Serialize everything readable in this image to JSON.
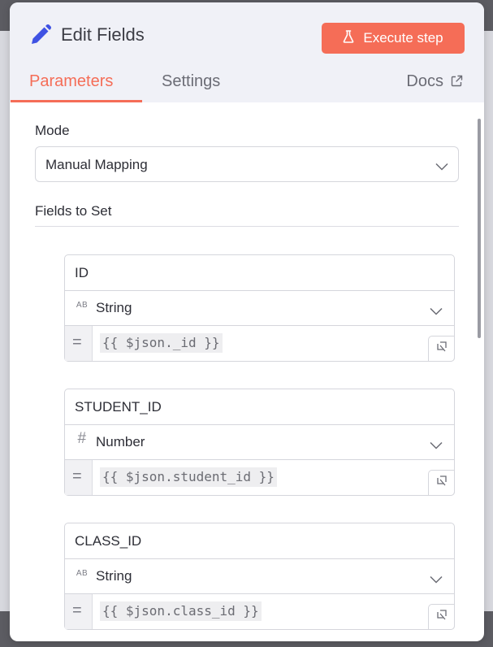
{
  "header": {
    "title": "Edit Fields",
    "execute_label": "Execute step",
    "tabs": [
      {
        "label": "Parameters",
        "active": true
      },
      {
        "label": "Settings",
        "active": false
      }
    ],
    "docs_label": "Docs"
  },
  "mode": {
    "label": "Mode",
    "value": "Manual Mapping"
  },
  "fields_section": {
    "label": "Fields to Set",
    "fields": [
      {
        "name": "ID",
        "type": "String",
        "type_icon": "AB",
        "expression": "{{ $json._id }}"
      },
      {
        "name": "STUDENT_ID",
        "type": "Number",
        "type_icon": "#",
        "expression": "{{ $json.student_id }}"
      },
      {
        "name": "CLASS_ID",
        "type": "String",
        "type_icon": "AB",
        "expression": "{{ $json.class_id }}"
      }
    ]
  },
  "colors": {
    "accent": "#f56d57",
    "header_bg": "#f0f1f7",
    "border": "#d5d6dc"
  },
  "icons": {
    "title": "pencil-icon",
    "execute": "flask-icon",
    "docs": "external-link-icon",
    "dropdown": "chevron-down-icon",
    "mapping": "mapping-toggle-icon",
    "equals": "equals-icon"
  }
}
